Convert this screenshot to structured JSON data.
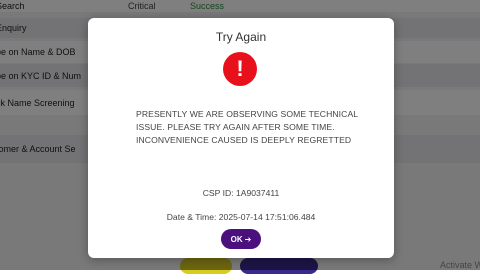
{
  "background": {
    "rows": {
      "search": "Search",
      "critical": "Critical",
      "success": "Success",
      "enquiry": "Enquiry",
      "name_dob": "pe on Name & DOB",
      "kyc": "pe on KYC ID & Num",
      "check_name": "ck Name Screening",
      "customer": "tomer & Account Se"
    },
    "watermark": "Activate Wi"
  },
  "modal": {
    "title": "Try Again",
    "icon": "error-icon",
    "icon_glyph": "!",
    "message": "PRESENTLY WE ARE OBSERVING SOME TECHNICAL ISSUE. PLEASE TRY AGAIN AFTER SOME TIME. INCONVENIENCE CAUSED IS DEEPLY REGRETTED",
    "csp_id": "CSP ID: 1A9037411",
    "datetime": "Date & Time: 2025-07-14 17:51:06.484",
    "ok_label": "OK",
    "ok_arrow": "➔"
  },
  "colors": {
    "error": "#e8101a",
    "ok_button": "#4b0f7e",
    "success": "#2e8b3a"
  }
}
